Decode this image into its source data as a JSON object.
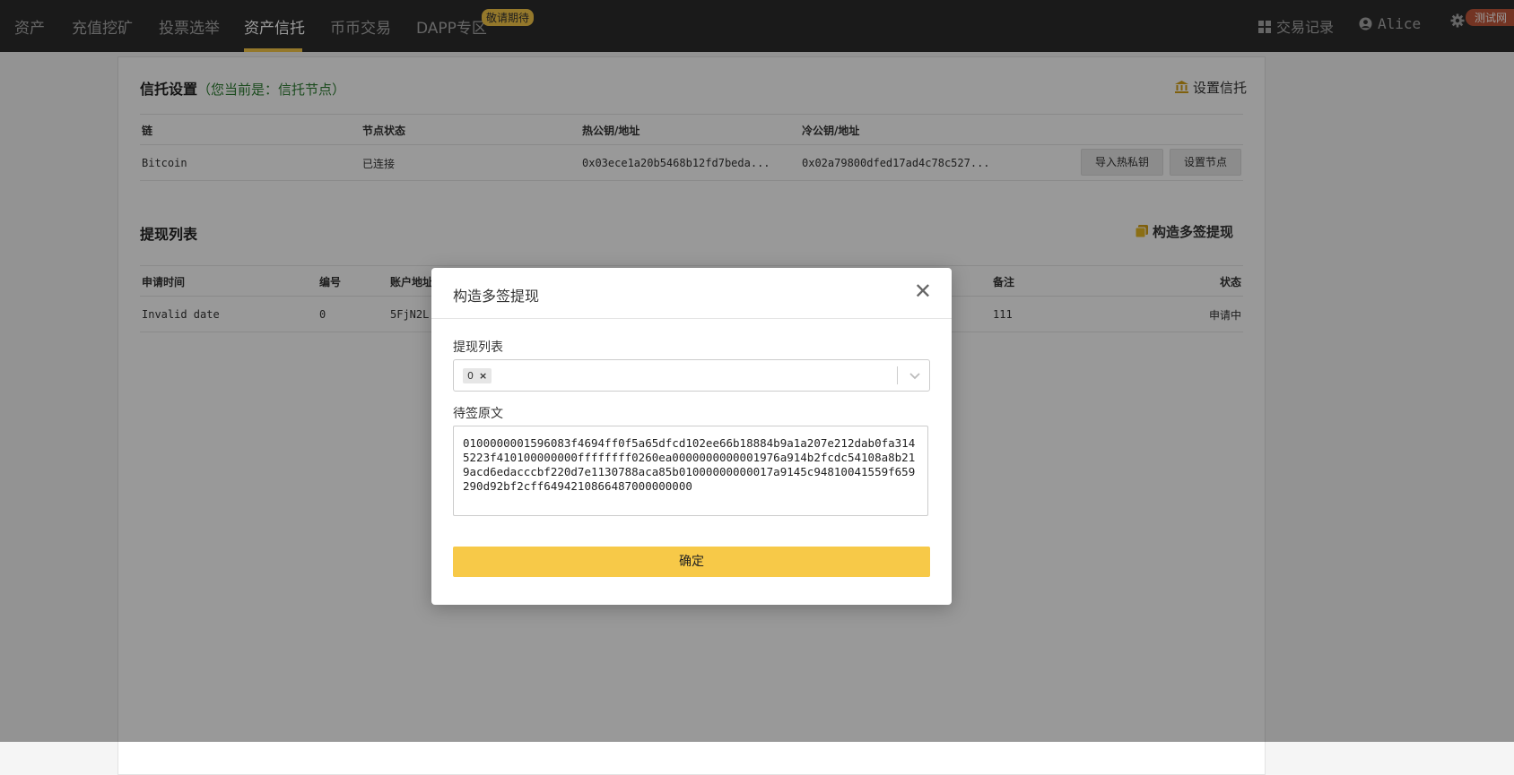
{
  "nav": {
    "items": [
      "资产",
      "充值挖矿",
      "投票选举",
      "资产信托",
      "币币交易",
      "DAPP专区"
    ],
    "active_index": 3,
    "dapp_badge": "敬请期待",
    "tx_record": "交易记录",
    "user": "Alice",
    "env_badge": "测试网"
  },
  "trust": {
    "title": "信托设置",
    "subtitle": "（您当前是：信托节点）",
    "action": "设置信托",
    "columns": [
      "链",
      "节点状态",
      "热公钥/地址",
      "冷公钥/地址"
    ],
    "row": {
      "chain": "Bitcoin",
      "status": "已连接",
      "hot": "0x03ece1a20b5468b12fd7beda...",
      "cold": "0x02a79800dfed17ad4c78c527..."
    },
    "btn_import": "导入热私钥",
    "btn_node": "设置节点"
  },
  "withdraw": {
    "title": "提现列表",
    "action": "构造多签提现",
    "columns": {
      "time": "申请时间",
      "id": "编号",
      "addr": "账户地址",
      "note": "备注",
      "status": "状态"
    },
    "row": {
      "time": "Invalid date",
      "id": "0",
      "addr": "5FjN2L",
      "note": "111",
      "status": "申请中"
    }
  },
  "modal": {
    "title": "构造多签提现",
    "list_label": "提现列表",
    "selected": [
      "0"
    ],
    "raw_label": "待签原文",
    "raw_text": "0100000001596083f4694ff0f5a65dfcd102ee66b18884b9a1a207e212dab0fa3145223f410100000000ffffffff0260ea0000000000001976a914b2fcdc54108a8b219acd6edacccbf220d7e1130788aca85b01000000000017a9145c94810041559f659290d92bf2cff6494210866487000000000",
    "confirm": "确定"
  },
  "colors": {
    "accent": "#f7c948",
    "nav_bg": "#2c2c2c",
    "env_badge": "#c0573b"
  }
}
